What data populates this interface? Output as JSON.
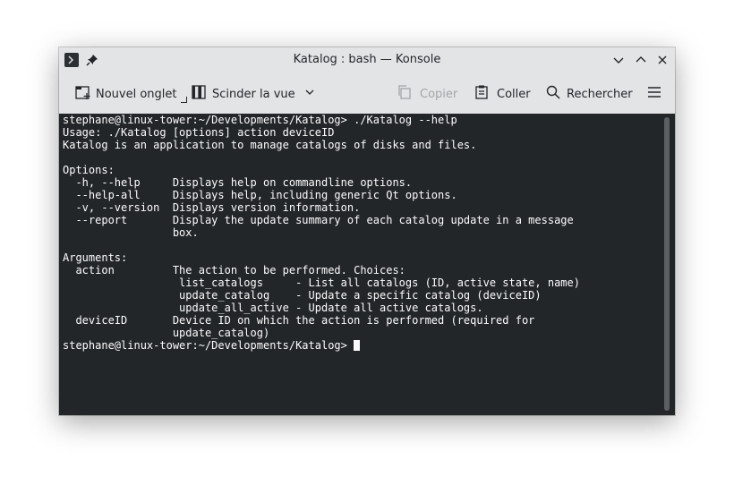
{
  "window": {
    "title": "Katalog : bash — Konsole"
  },
  "toolbar": {
    "new_tab_label": "Nouvel onglet",
    "split_view_label": "Scinder la vue",
    "copy_label": "Copier",
    "paste_label": "Coller",
    "search_label": "Rechercher"
  },
  "icons": {
    "app": "terminal-icon",
    "pin": "pin-icon",
    "minimize": "chevron-down-icon",
    "maximize": "chevron-up-icon",
    "close": "close-icon",
    "new_tab": "new-tab-icon",
    "split_view": "split-view-icon",
    "copy": "copy-icon",
    "paste": "paste-icon",
    "search": "search-icon",
    "menu": "hamburger-menu-icon"
  },
  "colors": {
    "terminal_background": "#232629",
    "terminal_foreground": "#fcfcfc",
    "chrome_background": "#e3e4e6",
    "disabled_text": "#a3a5a8"
  },
  "terminal": {
    "output": "stephane@linux-tower:~/Developments/Katalog> ./Katalog --help\nUsage: ./Katalog [options] action deviceID\nKatalog is an application to manage catalogs of disks and files.\n\nOptions:\n  -h, --help     Displays help on commandline options.\n  --help-all     Displays help, including generic Qt options.\n  -v, --version  Displays version information.\n  --report       Display the update summary of each catalog update in a message\n                 box.\n\nArguments:\n  action         The action to be performed. Choices:\n                  list_catalogs     - List all catalogs (ID, active state, name)\n                  update_catalog    - Update a specific catalog (deviceID)\n                  update_all_active - Update all active catalogs.\n  deviceID       Device ID on which the action is performed (required for\n                 update_catalog)",
    "prompt": "stephane@linux-tower:~/Developments/Katalog> "
  }
}
